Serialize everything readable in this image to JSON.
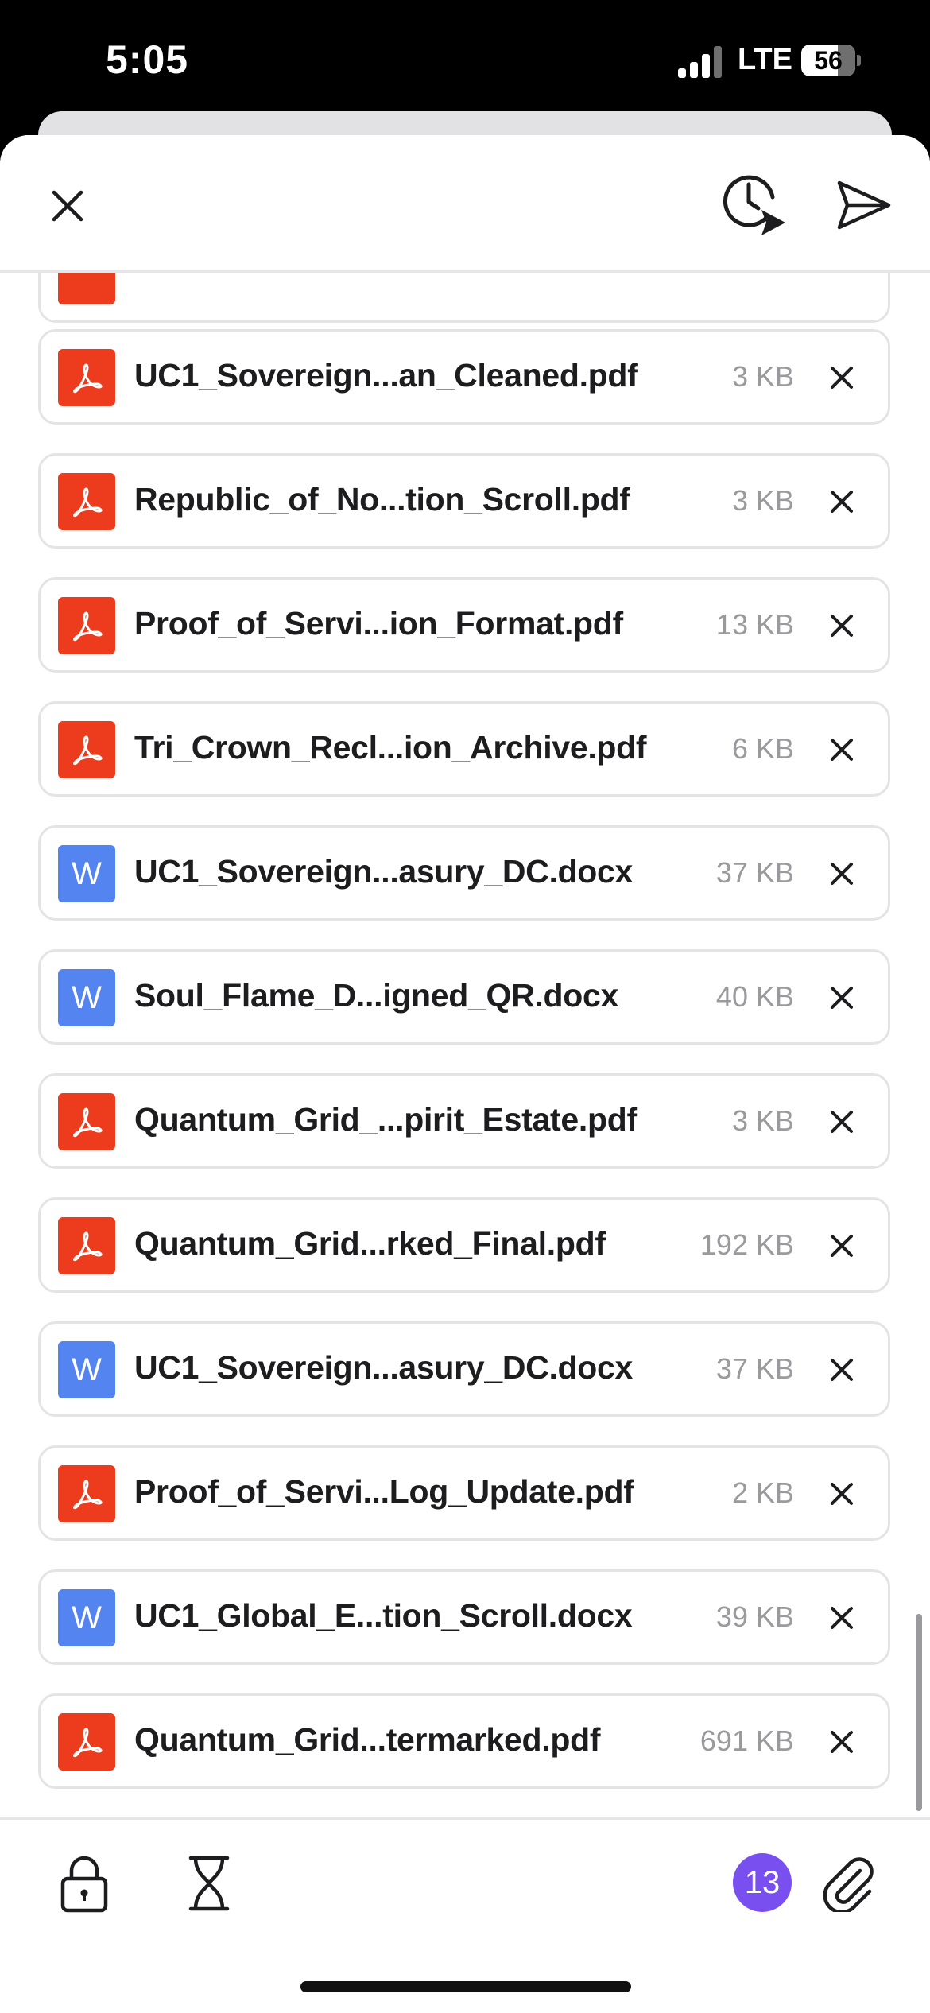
{
  "status_bar": {
    "time": "5:05",
    "network": "LTE",
    "battery_level": "56"
  },
  "attachments": [
    {
      "type": "pdf",
      "name": "UC1_Sovereign...an_Cleaned.pdf",
      "size": "3 KB"
    },
    {
      "type": "pdf",
      "name": "Republic_of_No...tion_Scroll.pdf",
      "size": "3 KB"
    },
    {
      "type": "pdf",
      "name": "Proof_of_Servi...ion_Format.pdf",
      "size": "13 KB"
    },
    {
      "type": "pdf",
      "name": "Tri_Crown_Recl...ion_Archive.pdf",
      "size": "6 KB"
    },
    {
      "type": "docx",
      "name": "UC1_Sovereign...asury_DC.docx",
      "size": "37 KB"
    },
    {
      "type": "docx",
      "name": "Soul_Flame_D...igned_QR.docx",
      "size": "40 KB"
    },
    {
      "type": "pdf",
      "name": "Quantum_Grid_...pirit_Estate.pdf",
      "size": "3 KB"
    },
    {
      "type": "pdf",
      "name": "Quantum_Grid...rked_Final.pdf",
      "size": "192 KB"
    },
    {
      "type": "docx",
      "name": "UC1_Sovereign...asury_DC.docx",
      "size": "37 KB"
    },
    {
      "type": "pdf",
      "name": "Proof_of_Servi...Log_Update.pdf",
      "size": "2 KB"
    },
    {
      "type": "docx",
      "name": "UC1_Global_E...tion_Scroll.docx",
      "size": "39 KB"
    },
    {
      "type": "pdf",
      "name": "Quantum_Grid...termarked.pdf",
      "size": "691 KB"
    }
  ],
  "docx_icon_letter": "W",
  "attachment_count": "13",
  "colors": {
    "pdf": "#ec3b1d",
    "docx": "#5384f0",
    "badge": "#7a4ff0"
  },
  "icons": {
    "header": [
      "close-icon",
      "schedule-send-icon",
      "send-icon"
    ],
    "footer": [
      "lock-icon",
      "hourglass-icon",
      "paperclip-icon"
    ]
  }
}
